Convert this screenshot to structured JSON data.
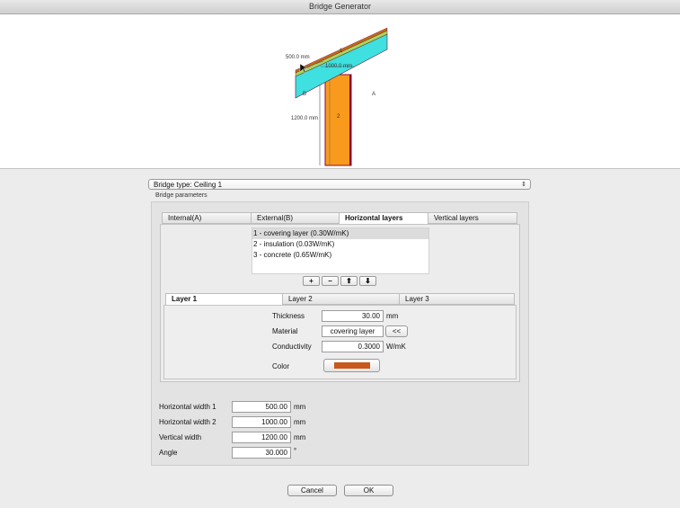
{
  "window": {
    "title": "Bridge Generator"
  },
  "diagram": {
    "dim_h1": "500.0 mm",
    "dim_h2": "1000.0 mm",
    "dim_v": "1200.0 mm",
    "label_a": "A",
    "label_b": "B",
    "label_1": "1",
    "label_2": "2",
    "colors": {
      "ceiling": "#3ee0e0",
      "wall": "#f99a1c",
      "covering": "#c46a1a",
      "insulation": "#a6d65a",
      "edge": "#8b0a3a"
    }
  },
  "bridge_type": {
    "label": "Bridge type: Ceiling 1"
  },
  "params": {
    "group_label": "Bridge parameters",
    "tabs": [
      "Internal(A)",
      "External(B)",
      "Horizontal layers",
      "Vertical layers"
    ],
    "active_tab": "Horizontal layers",
    "layers_list": [
      "1 - covering layer (0.30W/mK)",
      "2 - insulation (0.03W/mK)",
      "3 - concrete (0.65W/mK)"
    ],
    "list_buttons": {
      "add": "+",
      "remove": "−",
      "up": "⬆",
      "down": "⬇"
    },
    "layer_tabs": [
      "Layer 1",
      "Layer 2",
      "Layer 3"
    ],
    "layer": {
      "thickness_label": "Thickness",
      "thickness_value": "30.00",
      "thickness_unit": "mm",
      "material_label": "Material",
      "material_value": "covering layer",
      "material_button": "<<",
      "conductivity_label": "Conductivity",
      "conductivity_value": "0.3000",
      "conductivity_unit": "W/mK",
      "color_label": "Color",
      "color_value": "#c9581c"
    },
    "dims": [
      {
        "label": "Horizontal width 1",
        "value": "500.00",
        "unit": "mm"
      },
      {
        "label": "Horizontal width 2",
        "value": "1000.00",
        "unit": "mm"
      },
      {
        "label": "Vertical width",
        "value": "1200.00",
        "unit": "mm"
      },
      {
        "label": "Angle",
        "value": "30.000",
        "unit": "°"
      }
    ]
  },
  "footer": {
    "cancel": "Cancel",
    "ok": "OK"
  }
}
